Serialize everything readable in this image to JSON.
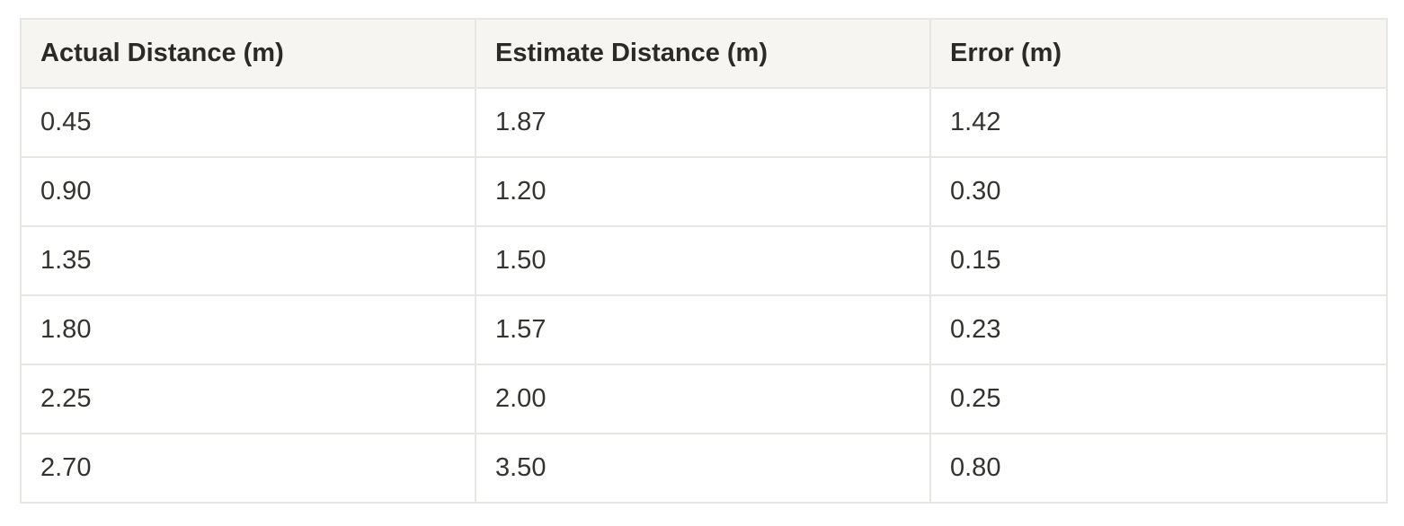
{
  "table": {
    "headers": [
      "Actual Distance (m)",
      "Estimate Distance (m)",
      "Error (m)"
    ],
    "rows": [
      [
        "0.45",
        "1.87",
        "1.42"
      ],
      [
        "0.90",
        "1.20",
        "0.30"
      ],
      [
        "1.35",
        "1.50",
        "0.15"
      ],
      [
        "1.80",
        "1.57",
        "0.23"
      ],
      [
        "2.25",
        "2.00",
        "0.25"
      ],
      [
        "2.70",
        "3.50",
        "0.80"
      ]
    ]
  }
}
